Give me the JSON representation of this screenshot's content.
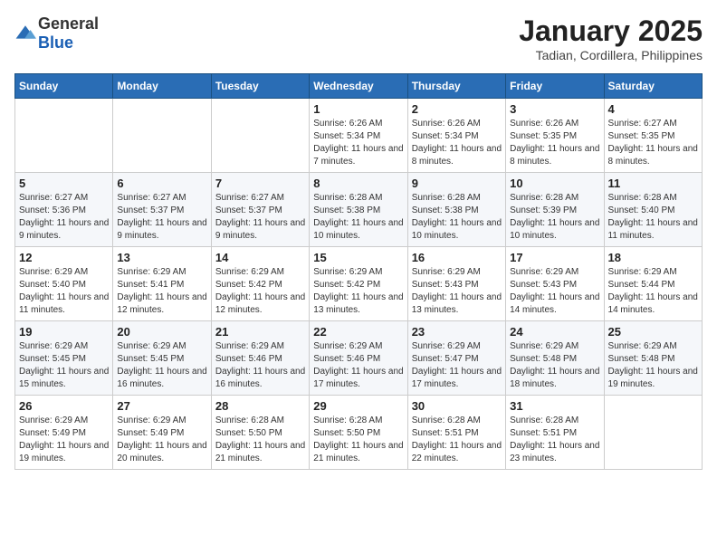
{
  "logo": {
    "general": "General",
    "blue": "Blue"
  },
  "title": "January 2025",
  "subtitle": "Tadian, Cordillera, Philippines",
  "days_of_week": [
    "Sunday",
    "Monday",
    "Tuesday",
    "Wednesday",
    "Thursday",
    "Friday",
    "Saturday"
  ],
  "weeks": [
    [
      {
        "day": "",
        "info": ""
      },
      {
        "day": "",
        "info": ""
      },
      {
        "day": "",
        "info": ""
      },
      {
        "day": "1",
        "info": "Sunrise: 6:26 AM\nSunset: 5:34 PM\nDaylight: 11 hours and 7 minutes."
      },
      {
        "day": "2",
        "info": "Sunrise: 6:26 AM\nSunset: 5:34 PM\nDaylight: 11 hours and 8 minutes."
      },
      {
        "day": "3",
        "info": "Sunrise: 6:26 AM\nSunset: 5:35 PM\nDaylight: 11 hours and 8 minutes."
      },
      {
        "day": "4",
        "info": "Sunrise: 6:27 AM\nSunset: 5:35 PM\nDaylight: 11 hours and 8 minutes."
      }
    ],
    [
      {
        "day": "5",
        "info": "Sunrise: 6:27 AM\nSunset: 5:36 PM\nDaylight: 11 hours and 9 minutes."
      },
      {
        "day": "6",
        "info": "Sunrise: 6:27 AM\nSunset: 5:37 PM\nDaylight: 11 hours and 9 minutes."
      },
      {
        "day": "7",
        "info": "Sunrise: 6:27 AM\nSunset: 5:37 PM\nDaylight: 11 hours and 9 minutes."
      },
      {
        "day": "8",
        "info": "Sunrise: 6:28 AM\nSunset: 5:38 PM\nDaylight: 11 hours and 10 minutes."
      },
      {
        "day": "9",
        "info": "Sunrise: 6:28 AM\nSunset: 5:38 PM\nDaylight: 11 hours and 10 minutes."
      },
      {
        "day": "10",
        "info": "Sunrise: 6:28 AM\nSunset: 5:39 PM\nDaylight: 11 hours and 10 minutes."
      },
      {
        "day": "11",
        "info": "Sunrise: 6:28 AM\nSunset: 5:40 PM\nDaylight: 11 hours and 11 minutes."
      }
    ],
    [
      {
        "day": "12",
        "info": "Sunrise: 6:29 AM\nSunset: 5:40 PM\nDaylight: 11 hours and 11 minutes."
      },
      {
        "day": "13",
        "info": "Sunrise: 6:29 AM\nSunset: 5:41 PM\nDaylight: 11 hours and 12 minutes."
      },
      {
        "day": "14",
        "info": "Sunrise: 6:29 AM\nSunset: 5:42 PM\nDaylight: 11 hours and 12 minutes."
      },
      {
        "day": "15",
        "info": "Sunrise: 6:29 AM\nSunset: 5:42 PM\nDaylight: 11 hours and 13 minutes."
      },
      {
        "day": "16",
        "info": "Sunrise: 6:29 AM\nSunset: 5:43 PM\nDaylight: 11 hours and 13 minutes."
      },
      {
        "day": "17",
        "info": "Sunrise: 6:29 AM\nSunset: 5:43 PM\nDaylight: 11 hours and 14 minutes."
      },
      {
        "day": "18",
        "info": "Sunrise: 6:29 AM\nSunset: 5:44 PM\nDaylight: 11 hours and 14 minutes."
      }
    ],
    [
      {
        "day": "19",
        "info": "Sunrise: 6:29 AM\nSunset: 5:45 PM\nDaylight: 11 hours and 15 minutes."
      },
      {
        "day": "20",
        "info": "Sunrise: 6:29 AM\nSunset: 5:45 PM\nDaylight: 11 hours and 16 minutes."
      },
      {
        "day": "21",
        "info": "Sunrise: 6:29 AM\nSunset: 5:46 PM\nDaylight: 11 hours and 16 minutes."
      },
      {
        "day": "22",
        "info": "Sunrise: 6:29 AM\nSunset: 5:46 PM\nDaylight: 11 hours and 17 minutes."
      },
      {
        "day": "23",
        "info": "Sunrise: 6:29 AM\nSunset: 5:47 PM\nDaylight: 11 hours and 17 minutes."
      },
      {
        "day": "24",
        "info": "Sunrise: 6:29 AM\nSunset: 5:48 PM\nDaylight: 11 hours and 18 minutes."
      },
      {
        "day": "25",
        "info": "Sunrise: 6:29 AM\nSunset: 5:48 PM\nDaylight: 11 hours and 19 minutes."
      }
    ],
    [
      {
        "day": "26",
        "info": "Sunrise: 6:29 AM\nSunset: 5:49 PM\nDaylight: 11 hours and 19 minutes."
      },
      {
        "day": "27",
        "info": "Sunrise: 6:29 AM\nSunset: 5:49 PM\nDaylight: 11 hours and 20 minutes."
      },
      {
        "day": "28",
        "info": "Sunrise: 6:28 AM\nSunset: 5:50 PM\nDaylight: 11 hours and 21 minutes."
      },
      {
        "day": "29",
        "info": "Sunrise: 6:28 AM\nSunset: 5:50 PM\nDaylight: 11 hours and 21 minutes."
      },
      {
        "day": "30",
        "info": "Sunrise: 6:28 AM\nSunset: 5:51 PM\nDaylight: 11 hours and 22 minutes."
      },
      {
        "day": "31",
        "info": "Sunrise: 6:28 AM\nSunset: 5:51 PM\nDaylight: 11 hours and 23 minutes."
      },
      {
        "day": "",
        "info": ""
      }
    ]
  ]
}
